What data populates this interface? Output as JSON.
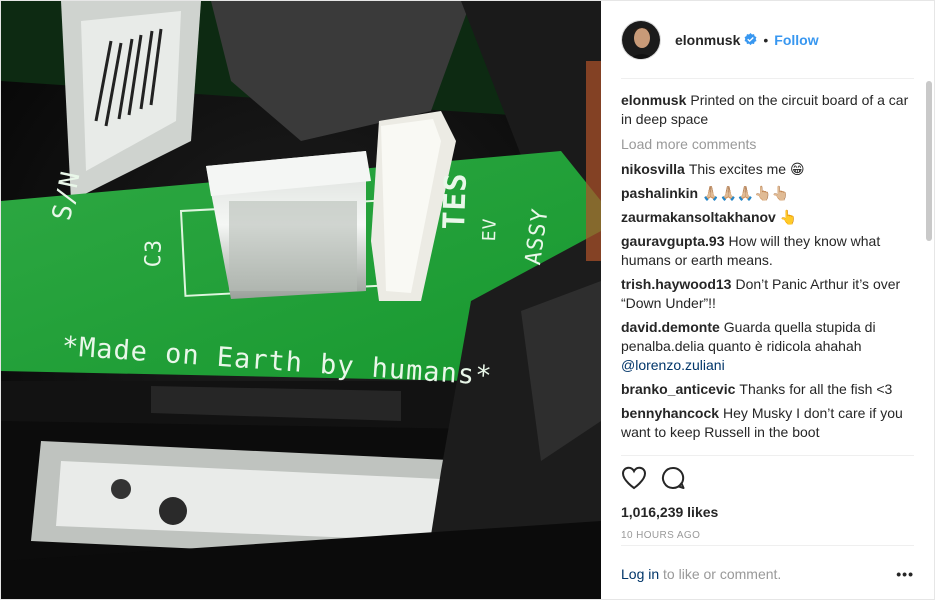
{
  "post": {
    "username": "elonmusk",
    "dot": "•",
    "follow_label": "Follow",
    "caption": "Printed on the circuit board of a car in deep space",
    "load_more": "Load more comments",
    "likes": "1,016,239 likes",
    "time": "10 HOURS AGO",
    "login_link": "Log in",
    "login_rest": "to like or comment.",
    "more_label": "•••"
  },
  "photo": {
    "main_text": "*Made on Earth by humans*",
    "sn": "S/N",
    "c3": "C3",
    "ev": "EV",
    "assy": "ASSY",
    "tes": "TES"
  },
  "comments": [
    {
      "user": "nikosvilla",
      "text": "This excites me 😁"
    },
    {
      "user": "pashalinkin",
      "text": "🙏🏼🙏🏼🙏🏼👆🏼👆🏼"
    },
    {
      "user": "zaurmakansoltakhanov",
      "text": "👆"
    },
    {
      "user": "gauravgupta.93",
      "text": "How will they know what humans or earth means."
    },
    {
      "user": "trish.haywood13",
      "text": "Don’t Panic Arthur it’s over “Down Under”!!"
    },
    {
      "user": "david.demonte",
      "text": "Guarda quella stupida di penalba.delia quanto è ridicola ahahah",
      "mention": "@lorenzo.zuliani"
    },
    {
      "user": "branko_anticevic",
      "text": "Thanks for all the fish <3"
    },
    {
      "user": "bennyhancock",
      "text": "Hey Musky I don’t care if you want to keep Russell in the boot"
    }
  ],
  "colors": {
    "accent": "#3897f0",
    "link": "#003569",
    "muted": "#999999",
    "pcb_green": "#1fae3a"
  },
  "icons": [
    "verified-badge-icon",
    "heart-icon",
    "comment-icon",
    "more-options-icon"
  ]
}
